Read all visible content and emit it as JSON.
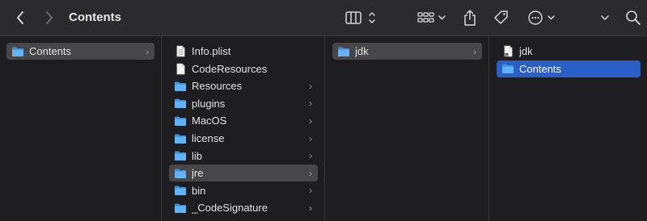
{
  "window": {
    "title": "Contents"
  },
  "toolbar": {
    "back_icon": "chevron-left-icon",
    "forward_icon": "chevron-right-icon",
    "view_icon": "columns-view-icon",
    "group_icon": "grid-group-icon",
    "share_icon": "share-icon",
    "tag_icon": "tag-icon",
    "action_icon": "ellipsis-circle-icon",
    "overflow_icon": "chevron-down-icon",
    "search_icon": "search-icon"
  },
  "columns": [
    {
      "items": [
        {
          "label": "Contents",
          "type": "folder",
          "has_children": true,
          "state": "selected"
        }
      ]
    },
    {
      "items": [
        {
          "label": "Info.plist",
          "type": "plist",
          "has_children": false,
          "state": ""
        },
        {
          "label": "CodeResources",
          "type": "file",
          "has_children": false,
          "state": ""
        },
        {
          "label": "Resources",
          "type": "folder",
          "has_children": true,
          "state": ""
        },
        {
          "label": "plugins",
          "type": "folder",
          "has_children": true,
          "state": ""
        },
        {
          "label": "MacOS",
          "type": "folder",
          "has_children": true,
          "state": ""
        },
        {
          "label": "license",
          "type": "folder",
          "has_children": true,
          "state": ""
        },
        {
          "label": "lib",
          "type": "folder",
          "has_children": true,
          "state": ""
        },
        {
          "label": "jre",
          "type": "folder",
          "has_children": true,
          "state": "selected"
        },
        {
          "label": "bin",
          "type": "folder",
          "has_children": true,
          "state": ""
        },
        {
          "label": "_CodeSignature",
          "type": "folder",
          "has_children": true,
          "state": ""
        }
      ]
    },
    {
      "items": [
        {
          "label": "jdk",
          "type": "folder",
          "has_children": true,
          "state": "selected"
        }
      ]
    },
    {
      "items": [
        {
          "label": "jdk",
          "type": "alias",
          "has_children": false,
          "state": ""
        },
        {
          "label": "Contents",
          "type": "folder",
          "has_children": false,
          "state": "active"
        }
      ]
    }
  ],
  "colors": {
    "accent": "#2a5fc8",
    "folder": "#5aaef5",
    "selection": "#47474a"
  }
}
